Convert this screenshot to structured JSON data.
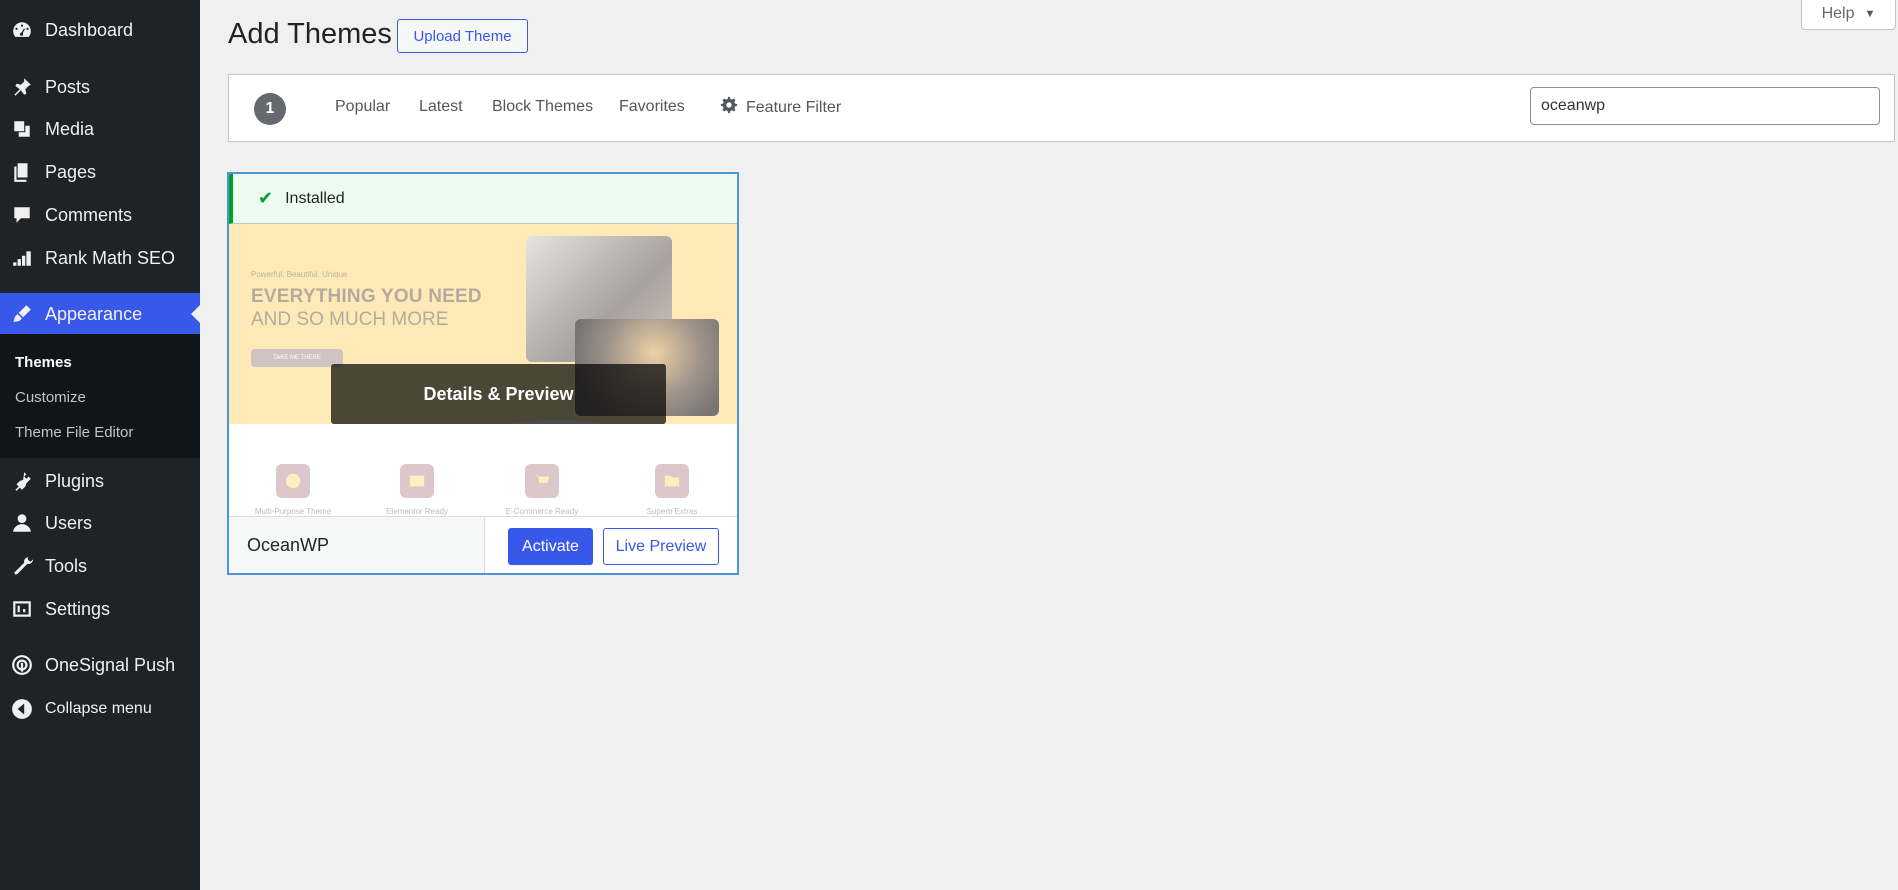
{
  "sidebar": {
    "items": [
      {
        "label": "Dashboard",
        "icon": "dashboard-icon"
      },
      {
        "label": "Posts",
        "icon": "pin-icon"
      },
      {
        "label": "Media",
        "icon": "media-icon"
      },
      {
        "label": "Pages",
        "icon": "pages-icon"
      },
      {
        "label": "Comments",
        "icon": "comment-icon"
      },
      {
        "label": "Rank Math SEO",
        "icon": "rank-math-icon"
      },
      {
        "label": "Appearance",
        "icon": "brush-icon"
      },
      {
        "label": "Plugins",
        "icon": "plugin-icon"
      },
      {
        "label": "Users",
        "icon": "user-icon"
      },
      {
        "label": "Tools",
        "icon": "wrench-icon"
      },
      {
        "label": "Settings",
        "icon": "settings-icon"
      },
      {
        "label": "OneSignal Push",
        "icon": "onesignal-icon"
      }
    ],
    "submenu": [
      "Themes",
      "Customize",
      "Theme File Editor"
    ],
    "collapse_label": "Collapse menu"
  },
  "header": {
    "title": "Add Themes",
    "upload_label": "Upload Theme",
    "help_label": "Help"
  },
  "filters": {
    "count": "1",
    "links": [
      "Popular",
      "Latest",
      "Block Themes",
      "Favorites"
    ],
    "feature_filter": "Feature Filter",
    "search_value": "oceanwp"
  },
  "theme": {
    "notice": "Installed",
    "overlay": "Details & Preview",
    "name": "OceanWP",
    "activate_label": "Activate",
    "preview_label": "Live Preview",
    "screenshot": {
      "tagline": "Powerful. Beautiful. Unique",
      "heading1": "EVERYTHING YOU NEED",
      "heading2": "AND SO MUCH MORE",
      "button": "TAKE ME THERE",
      "features": [
        "Multi-Purpose Theme",
        "Elementor Ready",
        "E-Commerce Ready",
        "Superb Extras"
      ]
    }
  },
  "colors": {
    "sidebar_bg": "#1d2327",
    "accent": "#3858e9",
    "installed_green": "#00a32a"
  }
}
